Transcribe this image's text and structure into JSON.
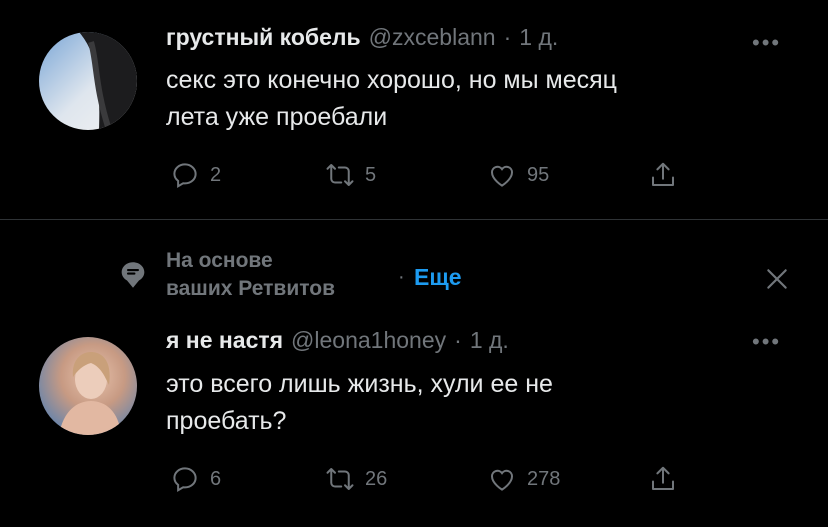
{
  "tweet1": {
    "name": "грустный кобель",
    "handle": "@zxceblann",
    "time": "1 д.",
    "text_line1": "секс это конечно хорошо, но мы месяц",
    "text_line2": "лета уже проебали",
    "replies": "2",
    "retweets": "5",
    "likes": "95"
  },
  "social_context": {
    "line1": "На основе",
    "line2": "ваших Ретвитов",
    "sep": "·",
    "more_label": "Еще",
    "close_label": "✕"
  },
  "tweet2": {
    "name": "я не настя",
    "handle": "@leona1honey",
    "time": "1 д.",
    "text_line1": "это всего лишь жизнь, хули ее не",
    "text_line2": "проебать?",
    "replies": "6",
    "retweets": "26",
    "likes": "278"
  },
  "menu_label": "•••",
  "colors": {
    "background": "#000000",
    "text": "#e7e9ea",
    "muted": "#71767b",
    "link": "#1d9bf0"
  }
}
